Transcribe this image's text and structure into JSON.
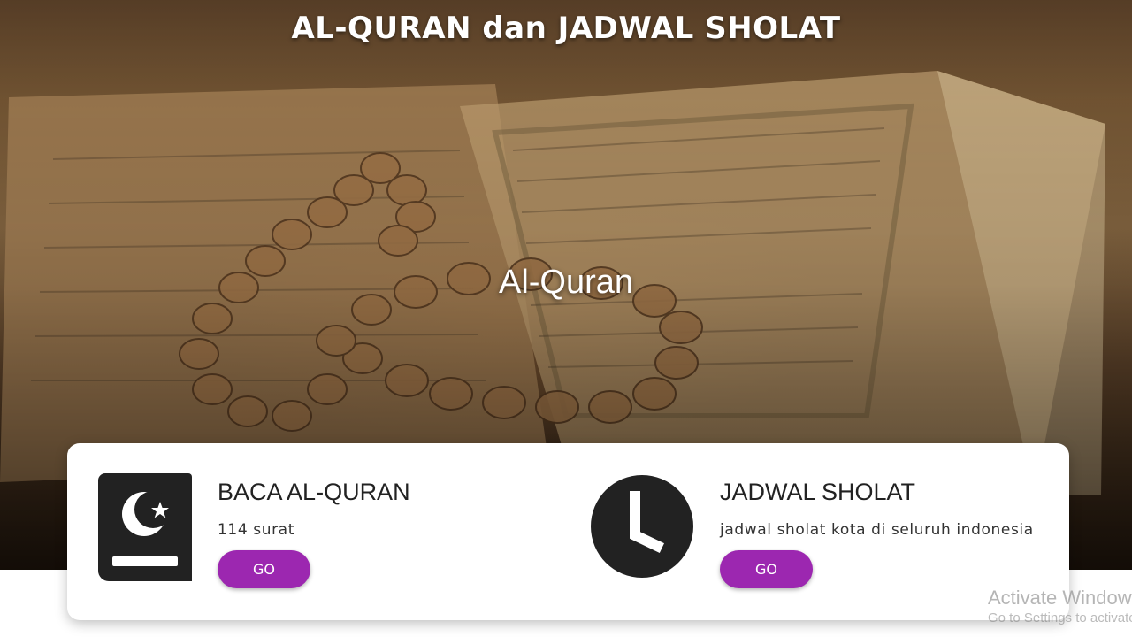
{
  "site": {
    "title": "AL-QURAN dan JADWAL SHOLAT"
  },
  "hero": {
    "heading": "Al-Quran"
  },
  "features": {
    "quran": {
      "icon": "quran-book-icon",
      "title": "BACA AL-QURAN",
      "subtitle": "114 surat",
      "button_label": "GO"
    },
    "sholat": {
      "icon": "clock-icon",
      "title": "JADWAL SHOLAT",
      "subtitle": "jadwal sholat kota di seluruh indonesia",
      "button_label": "GO"
    }
  },
  "watermark": {
    "title": "Activate Windows",
    "subtitle": "Go to Settings to activate Windows."
  },
  "colors": {
    "accent": "#9c27b0",
    "icon": "#222222",
    "card": "#ffffff",
    "text": "#222222"
  }
}
